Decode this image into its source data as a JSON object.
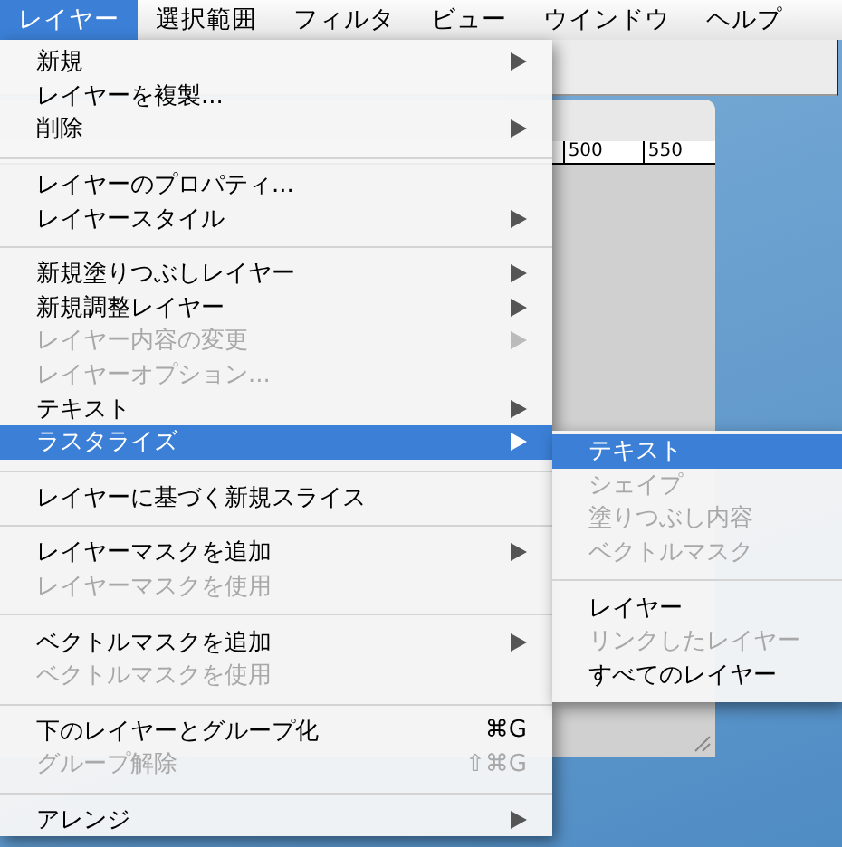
{
  "menubar": [
    {
      "label": "レイヤー",
      "selected": true
    },
    {
      "label": "選択範囲",
      "selected": false
    },
    {
      "label": "フィルタ",
      "selected": false
    },
    {
      "label": "ビュー",
      "selected": false
    },
    {
      "label": "ウインドウ",
      "selected": false
    },
    {
      "label": "ヘルプ",
      "selected": false
    }
  ],
  "document_window": {
    "ruler_labels": [
      "500",
      "550"
    ]
  },
  "menu": {
    "items": [
      {
        "kind": "item",
        "label": "新規",
        "disabled": false,
        "submenu": true,
        "highlighted": false
      },
      {
        "kind": "item",
        "label": "レイヤーを複製...",
        "disabled": false,
        "submenu": false,
        "highlighted": false
      },
      {
        "kind": "item",
        "label": "削除",
        "disabled": false,
        "submenu": true,
        "highlighted": false
      },
      {
        "kind": "separator"
      },
      {
        "kind": "item",
        "label": "レイヤーのプロパティ...",
        "disabled": false,
        "submenu": false,
        "highlighted": false
      },
      {
        "kind": "item",
        "label": "レイヤースタイル",
        "disabled": false,
        "submenu": true,
        "highlighted": false
      },
      {
        "kind": "separator"
      },
      {
        "kind": "item",
        "label": "新規塗りつぶしレイヤー",
        "disabled": false,
        "submenu": true,
        "highlighted": false
      },
      {
        "kind": "item",
        "label": "新規調整レイヤー",
        "disabled": false,
        "submenu": true,
        "highlighted": false
      },
      {
        "kind": "item",
        "label": "レイヤー内容の変更",
        "disabled": true,
        "submenu": true,
        "highlighted": false
      },
      {
        "kind": "item",
        "label": "レイヤーオプション...",
        "disabled": true,
        "submenu": false,
        "highlighted": false
      },
      {
        "kind": "item",
        "label": "テキスト",
        "disabled": false,
        "submenu": true,
        "highlighted": false
      },
      {
        "kind": "item",
        "label": "ラスタライズ",
        "disabled": false,
        "submenu": true,
        "highlighted": true
      },
      {
        "kind": "separator"
      },
      {
        "kind": "item",
        "label": "レイヤーに基づく新規スライス",
        "disabled": false,
        "submenu": false,
        "highlighted": false
      },
      {
        "kind": "separator"
      },
      {
        "kind": "item",
        "label": "レイヤーマスクを追加",
        "disabled": false,
        "submenu": true,
        "highlighted": false
      },
      {
        "kind": "item",
        "label": "レイヤーマスクを使用",
        "disabled": true,
        "submenu": false,
        "highlighted": false
      },
      {
        "kind": "separator"
      },
      {
        "kind": "item",
        "label": "ベクトルマスクを追加",
        "disabled": false,
        "submenu": true,
        "highlighted": false
      },
      {
        "kind": "item",
        "label": "ベクトルマスクを使用",
        "disabled": true,
        "submenu": false,
        "highlighted": false
      },
      {
        "kind": "separator"
      },
      {
        "kind": "item",
        "label": "下のレイヤーとグループ化",
        "disabled": false,
        "submenu": false,
        "highlighted": false,
        "shortcut": "⌘G"
      },
      {
        "kind": "item",
        "label": "グループ解除",
        "disabled": true,
        "submenu": false,
        "highlighted": false,
        "shortcut": "⇧⌘G"
      },
      {
        "kind": "separator"
      },
      {
        "kind": "item",
        "label": "アレンジ",
        "disabled": false,
        "submenu": true,
        "highlighted": false
      }
    ]
  },
  "submenu": {
    "items": [
      {
        "kind": "item",
        "label": "テキスト",
        "disabled": false,
        "highlighted": true
      },
      {
        "kind": "item",
        "label": "シェイプ",
        "disabled": true,
        "highlighted": false
      },
      {
        "kind": "item",
        "label": "塗りつぶし内容",
        "disabled": true,
        "highlighted": false
      },
      {
        "kind": "item",
        "label": "ベクトルマスク",
        "disabled": true,
        "highlighted": false
      },
      {
        "kind": "separator"
      },
      {
        "kind": "item",
        "label": "レイヤー",
        "disabled": false,
        "highlighted": false
      },
      {
        "kind": "item",
        "label": "リンクしたレイヤー",
        "disabled": true,
        "highlighted": false
      },
      {
        "kind": "item",
        "label": "すべてのレイヤー",
        "disabled": false,
        "highlighted": false
      }
    ]
  }
}
